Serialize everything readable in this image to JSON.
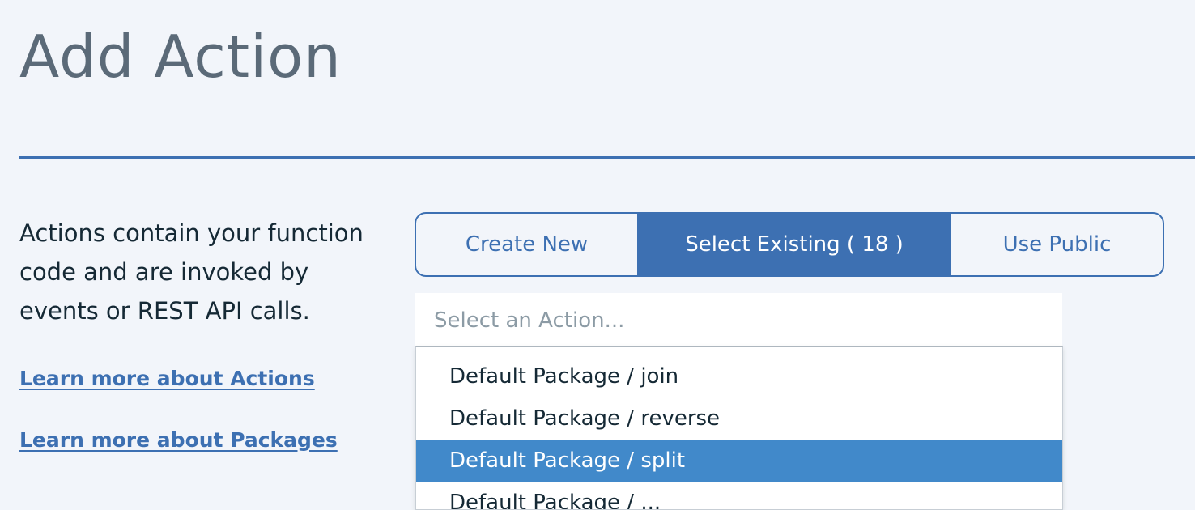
{
  "page": {
    "title": "Add Action"
  },
  "intro": {
    "description": "Actions contain your function code and are invoked by events or REST API calls.",
    "link_actions": "Learn more about Actions",
    "link_packages": "Learn more about Packages"
  },
  "tabs": [
    {
      "label": "Create New",
      "active": false
    },
    {
      "label": "Select Existing ( 18 )",
      "active": true
    },
    {
      "label": "Use Public",
      "active": false
    }
  ],
  "action_select": {
    "placeholder": "Select an Action...",
    "value": ""
  },
  "dropdown": {
    "options": [
      {
        "label": "Default Package / join",
        "selected": false
      },
      {
        "label": "Default Package / reverse",
        "selected": false
      },
      {
        "label": "Default Package / split",
        "selected": true
      },
      {
        "label": "Default Package / ...",
        "selected": false
      }
    ]
  },
  "colors": {
    "background": "#f2f5fa",
    "accent": "#3d70b2",
    "highlight": "#4189ca",
    "title_text": "#5b6a78",
    "body_text": "#152935"
  }
}
